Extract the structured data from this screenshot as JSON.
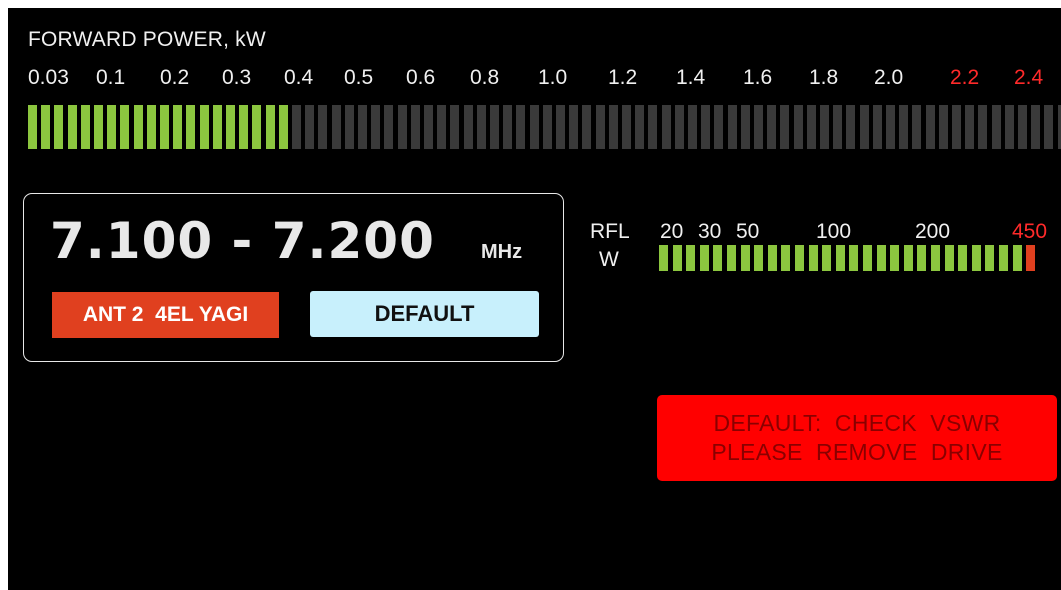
{
  "colors": {
    "background": "#000000",
    "text": "#f0f0f0",
    "warning_text": "#ff2a2a",
    "segment_lit": "#8cc63f",
    "segment_unlit": "#3a3a3a",
    "segment_danger": "#e0401f",
    "antenna_badge": "#e0401f",
    "profile_button": "#c8f0fc",
    "alarm_background": "#ff0000",
    "alarm_text": "#8a0000"
  },
  "forward_power": {
    "title": "FORWARD  POWER, kW",
    "scale": [
      {
        "label": "0.03",
        "warn": false
      },
      {
        "label": "0.1",
        "warn": false
      },
      {
        "label": "0.2",
        "warn": false
      },
      {
        "label": "0.3",
        "warn": false
      },
      {
        "label": "0.4",
        "warn": false
      },
      {
        "label": "0.5",
        "warn": false
      },
      {
        "label": "0.6",
        "warn": false
      },
      {
        "label": "0.8",
        "warn": false
      },
      {
        "label": "1.0",
        "warn": false
      },
      {
        "label": "1.2",
        "warn": false
      },
      {
        "label": "1.4",
        "warn": false
      },
      {
        "label": "1.6",
        "warn": false
      },
      {
        "label": "1.8",
        "warn": false
      },
      {
        "label": "2.0",
        "warn": false
      },
      {
        "label": "2.2",
        "warn": true
      },
      {
        "label": "2.4",
        "warn": true
      }
    ],
    "segments_total": 80,
    "segments_lit": 20
  },
  "frequency": {
    "range": "7.100 - 7.200",
    "unit": "MHz"
  },
  "antenna_label": "ANT 2  4EL YAGI",
  "profile_label": "DEFAULT",
  "reflected_power": {
    "label": "RFL",
    "unit": "W",
    "scale": [
      {
        "label": "20",
        "warn": false
      },
      {
        "label": "30",
        "warn": false
      },
      {
        "label": "50",
        "warn": false
      },
      {
        "label": "100",
        "warn": false
      },
      {
        "label": "200",
        "warn": false
      },
      {
        "label": "450",
        "warn": true
      }
    ],
    "segments_total": 28,
    "segments_lit": 27,
    "segments_danger": 1
  },
  "alarm": {
    "line1": "DEFAULT:  CHECK  VSWR",
    "line2": "PLEASE  REMOVE  DRIVE"
  }
}
